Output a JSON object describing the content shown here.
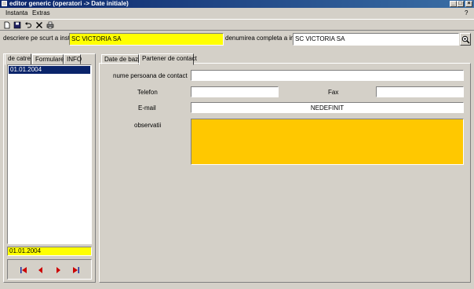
{
  "window": {
    "title": "editor generic (operatori -> Date initiale)",
    "buttons": [
      "_",
      "□",
      "×"
    ]
  },
  "menu": {
    "items": [
      "Instanta",
      "Extras"
    ],
    "help": "?"
  },
  "toolbar": {
    "icons": [
      "new-icon",
      "save-icon",
      "undo-icon",
      "delete-icon",
      "print-icon"
    ]
  },
  "header": {
    "short_label": "descriere pe scurt a inst...",
    "short_value": "SC VICTORIA SA",
    "full_label": "denumirea completa a in...",
    "full_value": "SC VICTORIA SA"
  },
  "left_tabs": [
    "de catre",
    "Formulare",
    "INFO"
  ],
  "left_list": {
    "items": [
      "01.01.2004"
    ],
    "selected_value": "01.01.2004"
  },
  "right_tabs": [
    "Date de baza",
    "Partener de contact"
  ],
  "form": {
    "contact_name_label": "nume persoana de contact",
    "contact_name_value": "",
    "phone_label": "Telefon",
    "phone_value": "",
    "fax_label": "Fax",
    "fax_value": "",
    "email_label": "E-mail",
    "email_value": "NEDEFINIT",
    "notes_label": "observatii",
    "notes_value": ""
  }
}
